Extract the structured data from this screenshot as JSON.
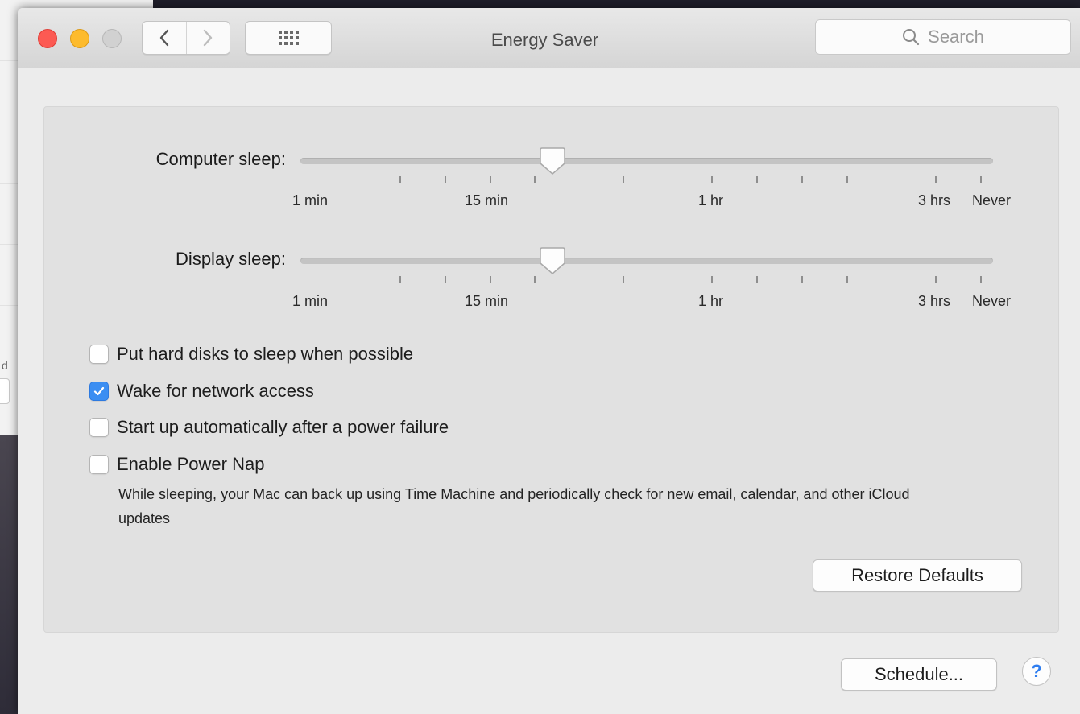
{
  "background": {
    "fragment_text": "d"
  },
  "window": {
    "title": "Energy Saver",
    "search_placeholder": "Search",
    "nav": {
      "back_icon": "chevron-left-icon",
      "forward_icon": "chevron-right-icon",
      "show_all_icon": "grid-icon"
    }
  },
  "sliders": {
    "tick_labels": [
      "1 min",
      "15 min",
      "1 hr",
      "3 hrs",
      "Never"
    ],
    "computer_sleep": {
      "label": "Computer sleep:",
      "value": "30 min"
    },
    "display_sleep": {
      "label": "Display sleep:",
      "value": "30 min"
    }
  },
  "options": [
    {
      "label": "Put hard disks to sleep when possible",
      "checked": false
    },
    {
      "label": "Wake for network access",
      "checked": true
    },
    {
      "label": "Start up automatically after a power failure",
      "checked": false
    },
    {
      "label": "Enable Power Nap",
      "checked": false
    }
  ],
  "power_nap_description": "While sleeping, your Mac can back up using Time Machine and periodically check for new email, calendar, and other iCloud updates",
  "buttons": {
    "restore_defaults": "Restore Defaults",
    "schedule": "Schedule...",
    "help": "?"
  },
  "colors": {
    "accent": "#3b8ef2",
    "close": "#fc5a53",
    "minimize": "#fdbb2d"
  }
}
